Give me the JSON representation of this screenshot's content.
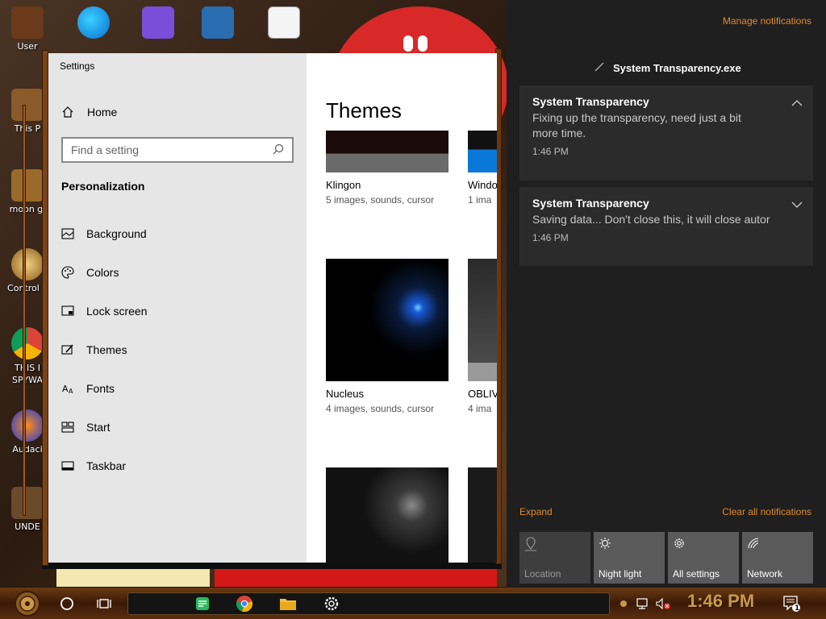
{
  "desktop": {
    "icons": [
      {
        "label": "User"
      },
      {
        "label": "This P"
      },
      {
        "label": "moon gi"
      },
      {
        "label": "Control P"
      },
      {
        "label": "THIS I SPYWA"
      },
      {
        "label": "Audaci"
      },
      {
        "label": "UNDE"
      }
    ],
    "top_icons": [
      "edge-icon",
      "visual-studio-icon",
      "virtualbox-icon",
      "hxd-icon"
    ]
  },
  "settings": {
    "window_title": "Settings",
    "home_label": "Home",
    "search_placeholder": "Find a setting",
    "section_title": "Personalization",
    "nav": [
      {
        "label": "Background",
        "icon": "image-icon"
      },
      {
        "label": "Colors",
        "icon": "palette-icon"
      },
      {
        "label": "Lock screen",
        "icon": "lock-screen-icon"
      },
      {
        "label": "Themes",
        "icon": "brush-icon",
        "selected": true
      },
      {
        "label": "Fonts",
        "icon": "font-icon"
      },
      {
        "label": "Start",
        "icon": "start-icon"
      },
      {
        "label": "Taskbar",
        "icon": "taskbar-icon"
      }
    ],
    "content_title": "Themes",
    "themes": [
      {
        "name": "Klingon",
        "desc": "5 images, sounds, cursor"
      },
      {
        "name": "Windo",
        "desc": "1 ima"
      },
      {
        "name": "Nucleus",
        "desc": "4 images, sounds, cursor"
      },
      {
        "name": "OBLIV",
        "desc": "4 ima"
      }
    ]
  },
  "action_center": {
    "manage_label": "Manage notifications",
    "app_name": "System Transparency.exe",
    "notifications": [
      {
        "title": "System Transparency",
        "body_line1": "Fixing up the transparency, need just a bit",
        "body_line2": "more time.",
        "time": "1:46 PM",
        "expanded": true
      },
      {
        "title": "System Transparency",
        "body_line1": "Saving data... Don't close this, it will close autor",
        "time": "1:46 PM",
        "expanded": false
      }
    ],
    "expand_label": "Expand",
    "clear_label": "Clear all notifications",
    "quick_actions": [
      {
        "label": "Location",
        "icon": "location-icon",
        "active": false
      },
      {
        "label": "Night light",
        "icon": "night-light-icon",
        "active": true
      },
      {
        "label": "All settings",
        "icon": "gear-icon",
        "active": true
      },
      {
        "label": "Network",
        "icon": "network-icon",
        "active": true
      }
    ]
  },
  "taskbar": {
    "clock": "1:46 PM",
    "notification_count": "1",
    "pinned": [
      "cortana-icon",
      "task-view-icon",
      "notes-icon",
      "chrome-icon",
      "file-explorer-icon",
      "settings-gear-icon"
    ]
  },
  "colors": {
    "accent_orange": "#e08a2c",
    "action_center_bg": "#1f1f1f",
    "notification_bg": "#2b2b2b",
    "settings_side_bg": "#e6e6e6",
    "taskbar_brown": "#5a2e10",
    "clock_gold": "#c89a4a"
  }
}
